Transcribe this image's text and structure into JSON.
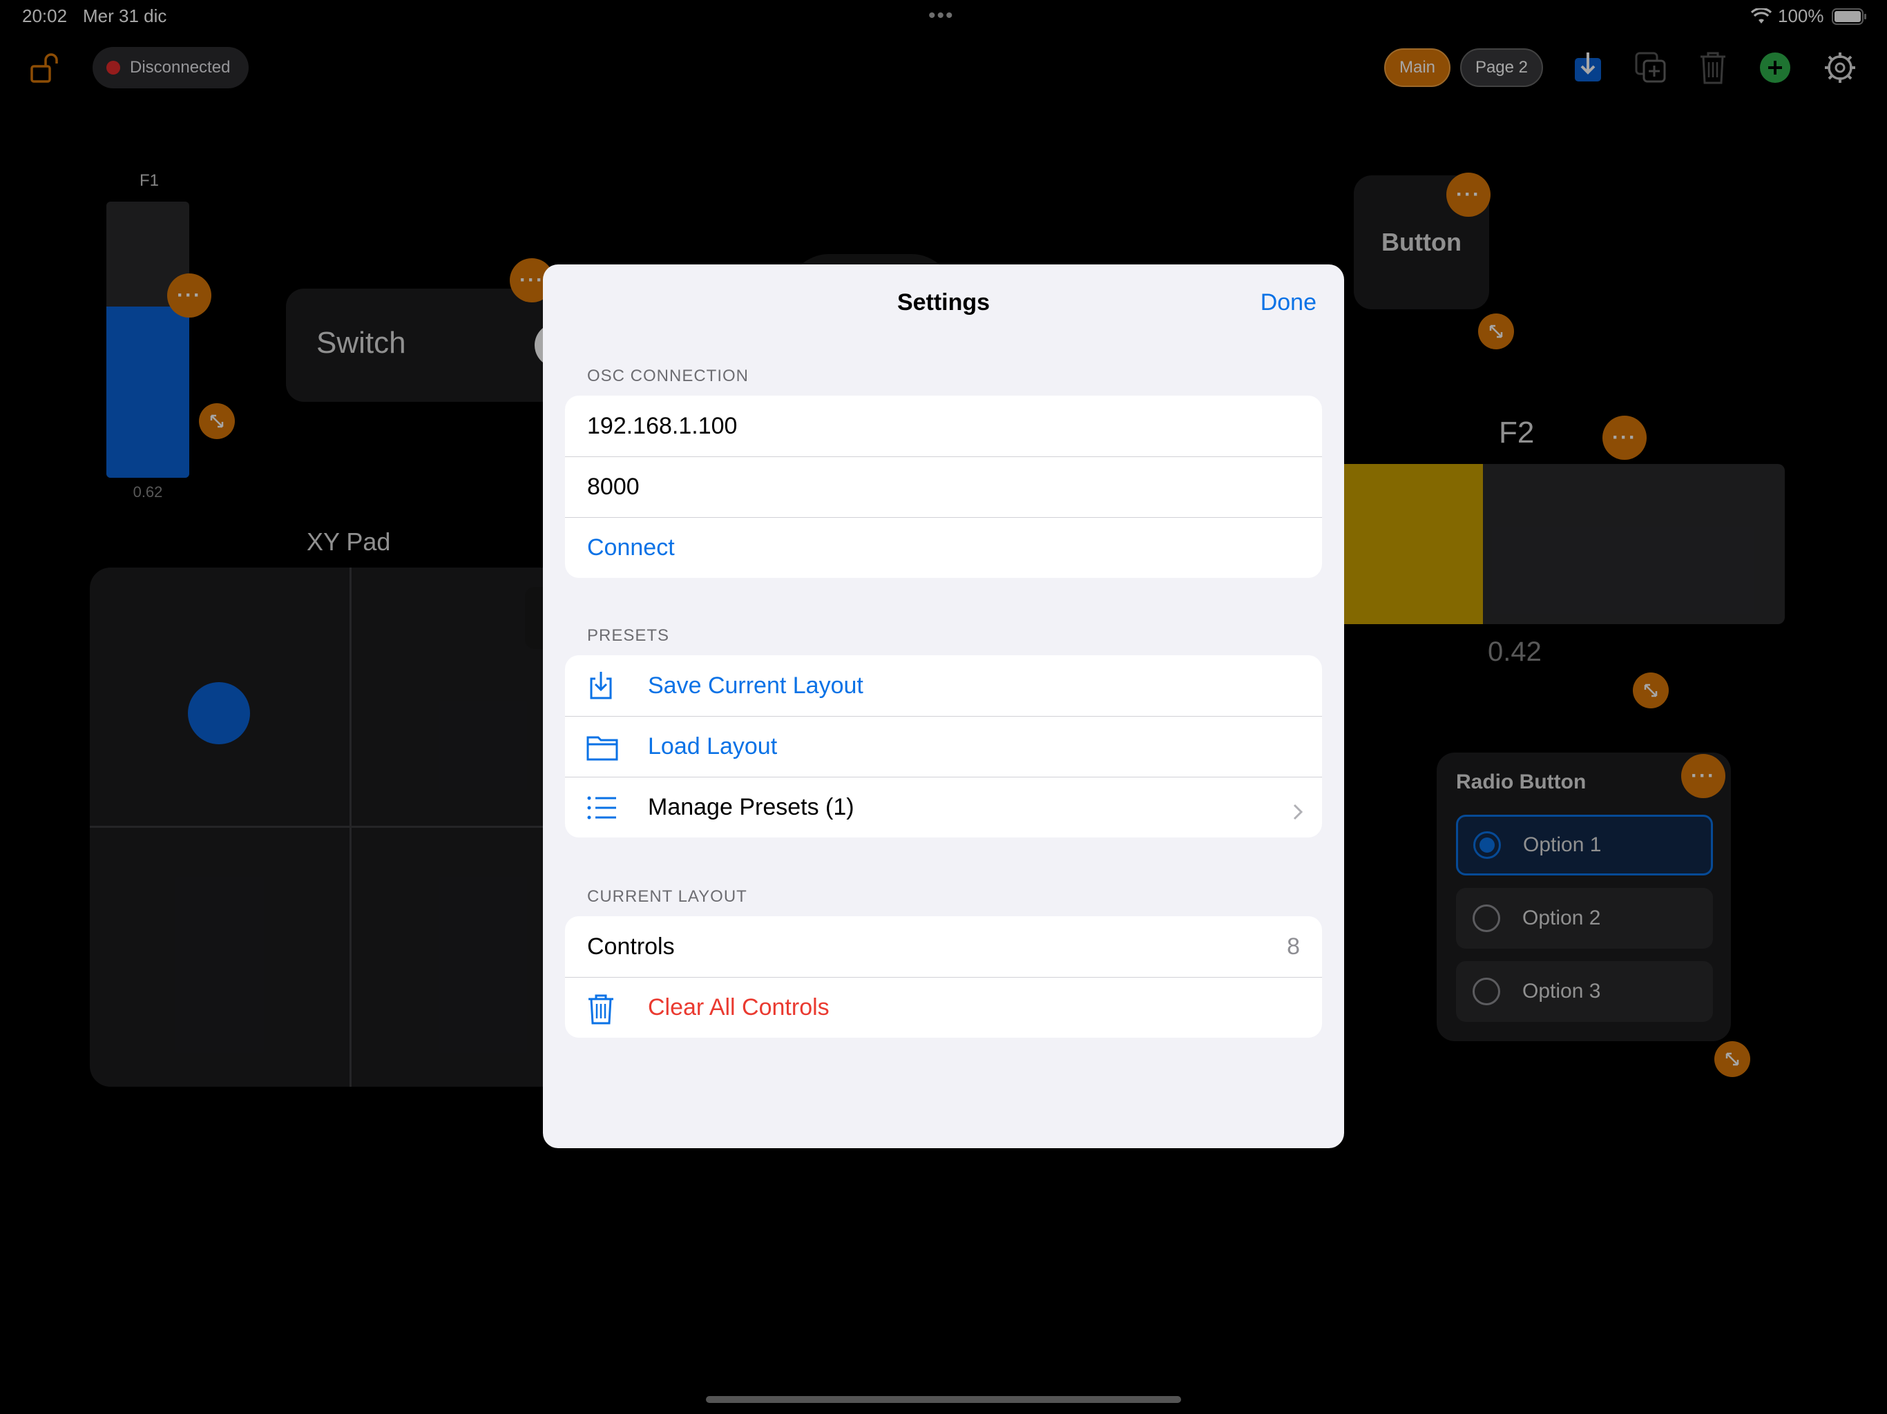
{
  "status_bar": {
    "time": "20:02",
    "date": "Mer 31 dic",
    "battery": "100%"
  },
  "top_bar": {
    "connection_status": "Disconnected",
    "pages": [
      "Main",
      "Page 2"
    ]
  },
  "controls": {
    "fader1": {
      "label": "F1",
      "value_text": "0.62",
      "value": 0.62,
      "color": "#0a63d8"
    },
    "switch": {
      "label": "Switch"
    },
    "button": {
      "label": "Button"
    },
    "fader2": {
      "label": "F2",
      "value_text": "0.42",
      "value": 0.42,
      "color": "#c9a000"
    },
    "xy_pad": {
      "label": "XY Pad"
    },
    "radio": {
      "title": "Radio Button",
      "options": [
        "Option 1",
        "Option 2",
        "Option 3"
      ],
      "selected": 0
    }
  },
  "settings": {
    "title": "Settings",
    "done": "Done",
    "osc": {
      "header": "OSC CONNECTION",
      "ip": "192.168.1.100",
      "port": "8000",
      "connect": "Connect"
    },
    "presets": {
      "header": "PRESETS",
      "save": "Save Current Layout",
      "load": "Load Layout",
      "manage": "Manage Presets (1)"
    },
    "current_layout": {
      "header": "CURRENT LAYOUT",
      "controls_label": "Controls",
      "controls_count": "8",
      "clear": "Clear All Controls"
    }
  },
  "colors": {
    "accent_orange": "#d97708",
    "ios_blue": "#0a72e6",
    "destructive_red": "#ea3a30",
    "add_green": "#2fb14c"
  }
}
